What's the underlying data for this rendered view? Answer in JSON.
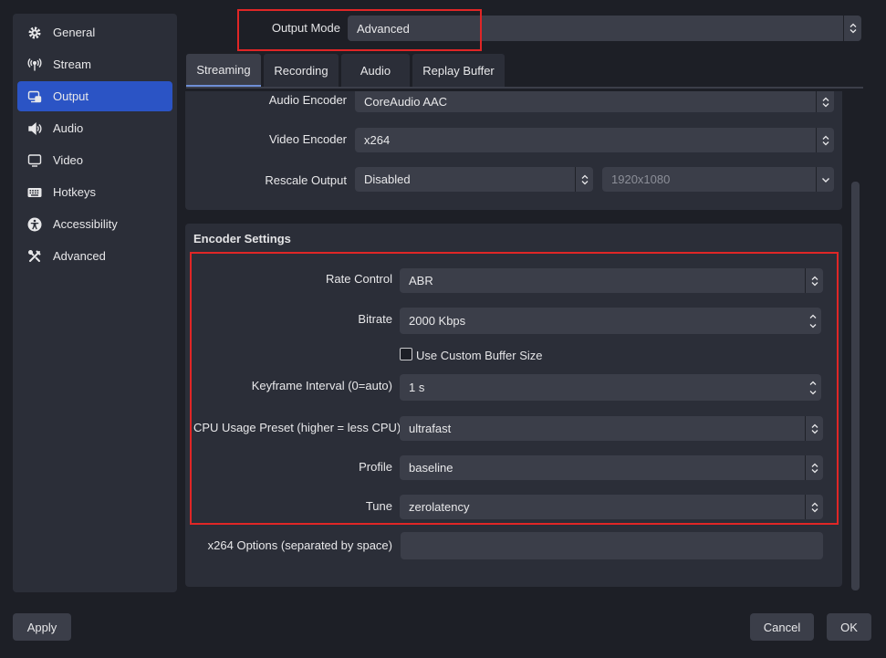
{
  "sidebar": {
    "items": [
      {
        "label": "General",
        "icon": "gear-icon"
      },
      {
        "label": "Stream",
        "icon": "antenna-icon"
      },
      {
        "label": "Output",
        "icon": "output-icon",
        "active": true
      },
      {
        "label": "Audio",
        "icon": "speaker-icon"
      },
      {
        "label": "Video",
        "icon": "monitor-icon"
      },
      {
        "label": "Hotkeys",
        "icon": "keyboard-icon"
      },
      {
        "label": "Accessibility",
        "icon": "accessibility-icon"
      },
      {
        "label": "Advanced",
        "icon": "tools-icon"
      }
    ]
  },
  "output_mode": {
    "label": "Output Mode",
    "value": "Advanced"
  },
  "tabs": [
    {
      "label": "Streaming",
      "active": true
    },
    {
      "label": "Recording"
    },
    {
      "label": "Audio"
    },
    {
      "label": "Replay Buffer"
    }
  ],
  "streaming": {
    "audio_encoder": {
      "label": "Audio Encoder",
      "value": "CoreAudio AAC"
    },
    "video_encoder": {
      "label": "Video Encoder",
      "value": "x264"
    },
    "rescale_output": {
      "label": "Rescale Output",
      "value": "Disabled",
      "resolution": "1920x1080"
    }
  },
  "encoder_settings": {
    "title": "Encoder Settings",
    "rate_control": {
      "label": "Rate Control",
      "value": "ABR"
    },
    "bitrate": {
      "label": "Bitrate",
      "value": "2000 Kbps"
    },
    "custom_buffer": {
      "label": "Use Custom Buffer Size",
      "checked": false
    },
    "keyframe_interval": {
      "label": "Keyframe Interval (0=auto)",
      "value": "1 s"
    },
    "cpu_preset": {
      "label": "CPU Usage Preset (higher = less CPU)",
      "value": "ultrafast"
    },
    "profile": {
      "label": "Profile",
      "value": "baseline"
    },
    "tune": {
      "label": "Tune",
      "value": "zerolatency"
    },
    "x264_options": {
      "label": "x264 Options (separated by space)",
      "value": ""
    }
  },
  "buttons": {
    "apply": "Apply",
    "cancel": "Cancel",
    "ok": "OK"
  },
  "colors": {
    "accent": "#2b54c5",
    "highlight_box": "#e02626",
    "background": "#1d1f26",
    "panel": "#2b2e38",
    "control": "#3b3e49"
  }
}
